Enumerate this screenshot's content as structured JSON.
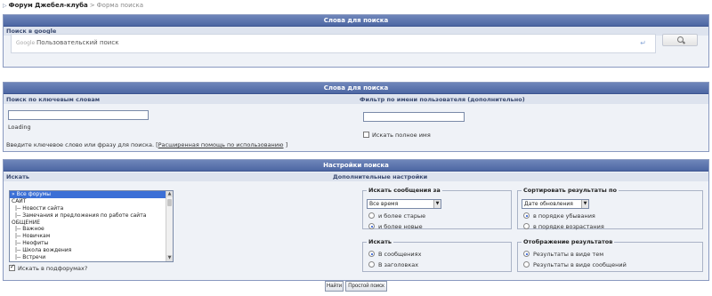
{
  "breadcrumb": {
    "forum": "Форум Джебел-клуба",
    "separator": ">",
    "current": "Форма поиска"
  },
  "google_panel": {
    "title": "Слова для поиска",
    "subheader": "Поиск в google",
    "logo_text": "Google",
    "placeholder": "Пользовательский поиск",
    "enter_glyph": "↵"
  },
  "keyword_panel": {
    "title": "Слова для поиска",
    "left_header": "Поиск по ключевым словам",
    "right_header": "Фильтр по имени пользователя (дополнительно)",
    "keyword_value": "",
    "username_value": "",
    "loading_text": "Loading",
    "hint_text": "Введите ключевое слово или фразу для поиска. [",
    "hint_link": "Расширенная помощь по использованию",
    "hint_end": "]",
    "full_name_label": "Искать полное имя",
    "full_name_checked": false
  },
  "settings_panel": {
    "title": "Настройки поиска",
    "left_header": "Искать",
    "right_header": "Дополнительные настройки",
    "forum_list": [
      {
        "label": "» Все форумы",
        "selected": true,
        "child": false
      },
      {
        "label": "САЙТ",
        "selected": false,
        "child": false
      },
      {
        "label": "|-- Новости сайта",
        "selected": false,
        "child": true
      },
      {
        "label": "|-- Замечания и предложения по работе сайта",
        "selected": false,
        "child": true
      },
      {
        "label": "ОБЩЕНИЕ",
        "selected": false,
        "child": false
      },
      {
        "label": "|-- Важное",
        "selected": false,
        "child": true
      },
      {
        "label": "|-- Новичкам",
        "selected": false,
        "child": true
      },
      {
        "label": "|-- Неофиты",
        "selected": false,
        "child": true
      },
      {
        "label": "|-- Школа вождения",
        "selected": false,
        "child": true
      },
      {
        "label": "|-- Встречи",
        "selected": false,
        "child": true
      }
    ],
    "subforums_label": "Искать в подфорумах?",
    "subforums_checked": true,
    "messages_for": {
      "legend": "Искать сообщения за",
      "select_value": "Все время",
      "options": [
        {
          "label": "и более старые",
          "on": false
        },
        {
          "label": "и более новые",
          "on": true
        }
      ]
    },
    "sort_by": {
      "legend": "Сортировать результаты по",
      "select_value": "Дате обновления",
      "options": [
        {
          "label": "в порядке убывания",
          "on": true
        },
        {
          "label": "в порядке возрастания",
          "on": false
        }
      ]
    },
    "search_in": {
      "legend": "Искать",
      "options": [
        {
          "label": "В сообщениях",
          "on": true
        },
        {
          "label": "В заголовках",
          "on": false
        }
      ]
    },
    "display": {
      "legend": "Отображение результатов",
      "options": [
        {
          "label": "Результаты в виде тем",
          "on": true
        },
        {
          "label": "Результаты в виде сообщений",
          "on": false
        }
      ]
    },
    "buttons": {
      "find": "Найти",
      "simple": "Простой поиск"
    }
  }
}
